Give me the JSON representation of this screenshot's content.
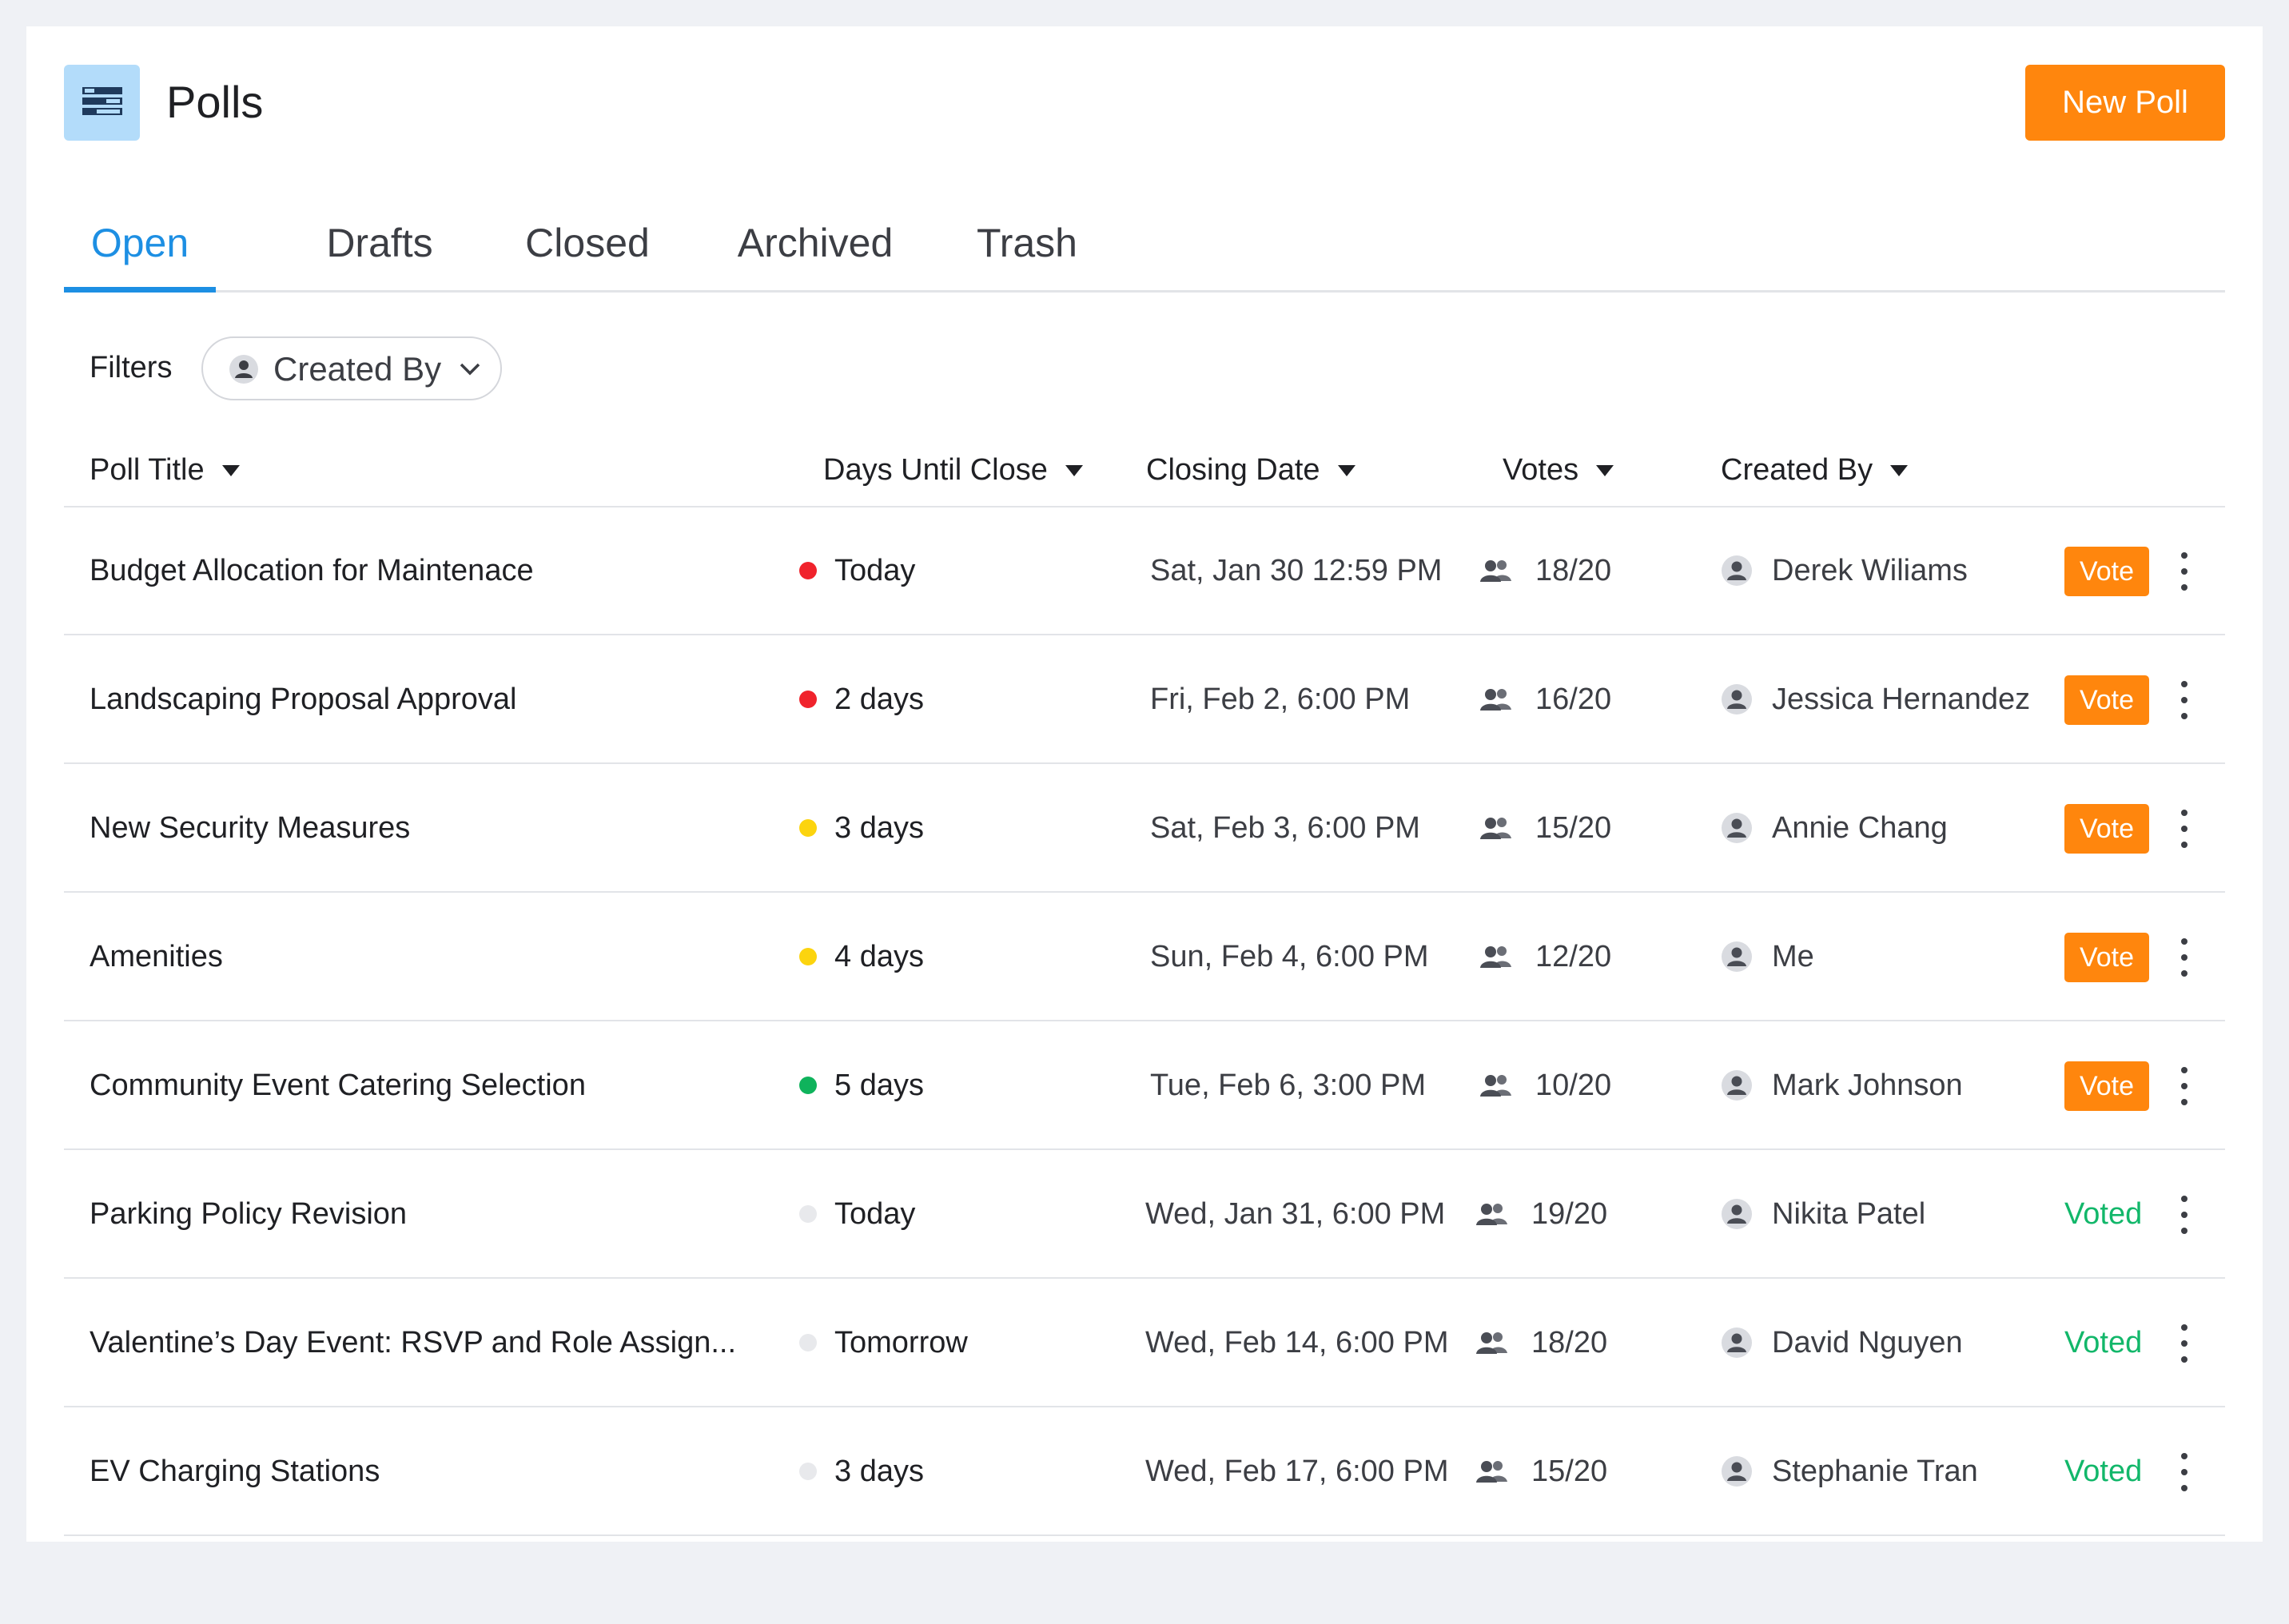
{
  "header": {
    "title": "Polls",
    "new_poll_label": "New Poll"
  },
  "tabs": [
    {
      "label": "Open",
      "active": true
    },
    {
      "label": "Drafts",
      "active": false
    },
    {
      "label": "Closed",
      "active": false
    },
    {
      "label": "Archived",
      "active": false
    },
    {
      "label": "Trash",
      "active": false
    }
  ],
  "filters": {
    "label": "Filters",
    "created_by_label": "Created By"
  },
  "columns": {
    "title": "Poll Title",
    "days": "Days Until Close",
    "date": "Closing Date",
    "votes": "Votes",
    "creator": "Created By"
  },
  "status_colors": {
    "red": "#f0232c",
    "yellow": "#fcd40e",
    "green": "#0fb35c",
    "none": "#e8e9ec"
  },
  "rows": [
    {
      "title": "Budget Allocation for Maintenace",
      "days": "Today",
      "status": "red",
      "date": "Sat, Jan 30 12:59 PM",
      "votes": "18/20",
      "creator": "Derek Wiliams",
      "action": "Vote"
    },
    {
      "title": "Landscaping Proposal Approval",
      "days": "2 days",
      "status": "red",
      "date": "Fri, Feb 2, 6:00 PM",
      "votes": "16/20",
      "creator": "Jessica Hernandez",
      "action": "Vote"
    },
    {
      "title": "New Security Measures",
      "days": "3 days",
      "status": "yellow",
      "date": "Sat, Feb 3, 6:00 PM",
      "votes": "15/20",
      "creator": "Annie Chang",
      "action": "Vote"
    },
    {
      "title": "Amenities",
      "days": "4 days",
      "status": "yellow",
      "date": "Sun, Feb 4, 6:00 PM",
      "votes": "12/20",
      "creator": "Me",
      "action": "Vote"
    },
    {
      "title": "Community Event Catering Selection",
      "days": "5 days",
      "status": "green",
      "date": "Tue, Feb 6, 3:00 PM",
      "votes": "10/20",
      "creator": "Mark Johnson",
      "action": "Vote"
    },
    {
      "title": "Parking Policy Revision",
      "days": "Today",
      "status": "none",
      "date": "Wed, Jan 31, 6:00 PM",
      "votes": "19/20",
      "creator": "Nikita Patel",
      "action": "Voted"
    },
    {
      "title": "Valentine’s Day Event: RSVP and Role Assign...",
      "days": "Tomorrow",
      "status": "none",
      "date": "Wed, Feb 14, 6:00 PM",
      "votes": "18/20",
      "creator": "David Nguyen",
      "action": "Voted"
    },
    {
      "title": "EV Charging Stations",
      "days": "3 days",
      "status": "none",
      "date": "Wed, Feb 17, 6:00 PM",
      "votes": "15/20",
      "creator": "Stephanie Tran",
      "action": "Voted"
    }
  ]
}
